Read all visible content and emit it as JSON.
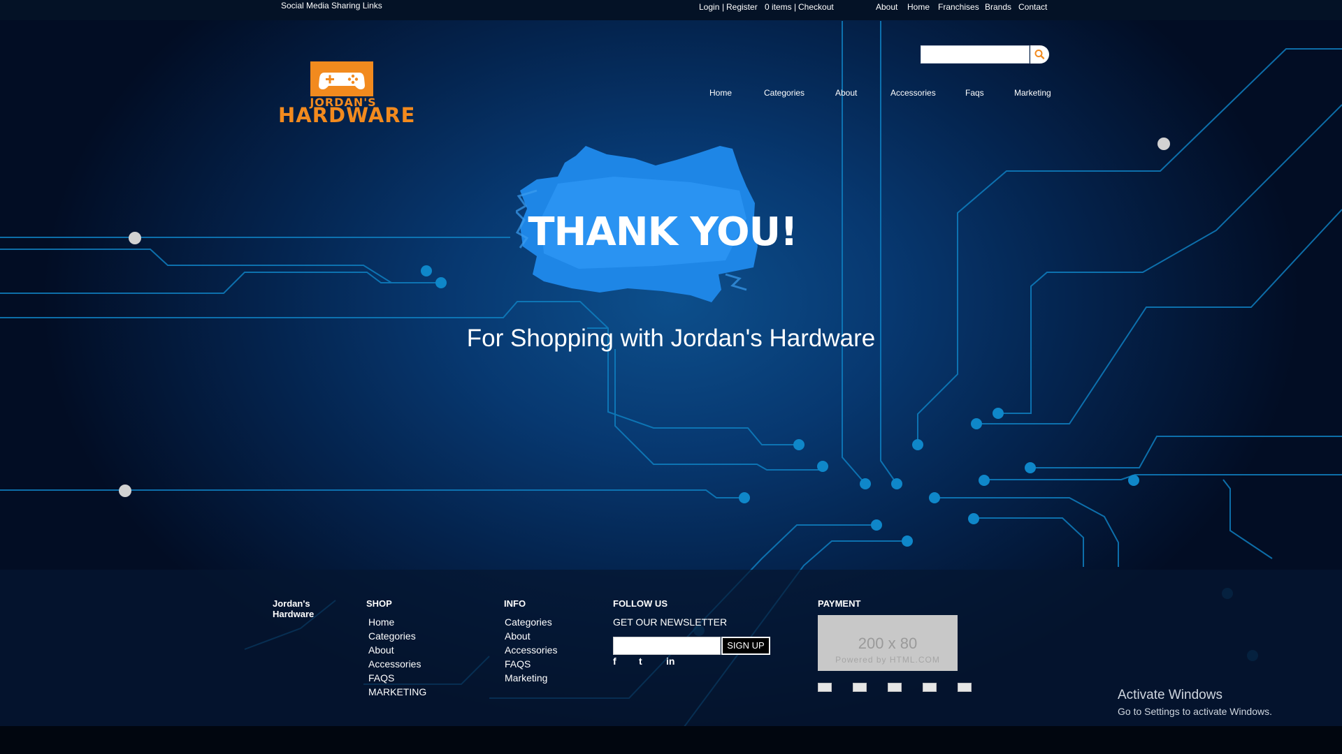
{
  "topbar": {
    "social_text": "Social Media Sharing Links",
    "login": "Login",
    "sep1": "|",
    "register": "Register",
    "cart_items": "0 items",
    "sep2": "|",
    "checkout": "Checkout",
    "links": [
      "About",
      "Home",
      "Franchises",
      "Brands",
      "Contact"
    ]
  },
  "logo": {
    "line1": "JORDAN'S",
    "line2": "HARDWARE",
    "icon": "gamepad-icon",
    "color": "#f28a1e"
  },
  "search": {
    "placeholder": "",
    "icon": "search-icon",
    "icon_color": "#f28a1e"
  },
  "nav": {
    "items": [
      "Home",
      "Categories",
      "About",
      "Accessories",
      "Faqs",
      "Marketing"
    ]
  },
  "hero": {
    "title": "THANK YOU!",
    "subtitle": "For Shopping with Jordan's Hardware",
    "brush_color": "#2a8ff0"
  },
  "footer": {
    "brand": "Jordan's\nHardware",
    "shop": {
      "title": "SHOP",
      "links": [
        "Home",
        "Categories",
        "About",
        "Accessories",
        "FAQS",
        "MARKETING"
      ]
    },
    "info": {
      "title": "INFO",
      "links": [
        "Categories",
        "About",
        "Accessories",
        "FAQS",
        "Marketing"
      ]
    },
    "follow": {
      "title": "FOLLOW US",
      "newsletter_label": "GET OUR NEWSLETTER",
      "newsletter_value": "",
      "signup_label": "SIGN UP",
      "social": [
        {
          "icon": "facebook-icon",
          "glyph": "f"
        },
        {
          "icon": "tumblr-icon",
          "glyph": "t"
        },
        {
          "icon": "linkedin-icon",
          "glyph": "in"
        }
      ]
    },
    "payment": {
      "title": "PAYMENT",
      "placeholder_size": "200 x 80",
      "placeholder_credit": "Powered by HTML.COM",
      "icons": [
        "payment-card-icon",
        "payment-card-icon",
        "payment-card-icon",
        "payment-card-icon",
        "payment-card-icon"
      ]
    }
  },
  "os_overlay": {
    "title": "Activate Windows",
    "subtitle": "Go to Settings to activate Windows."
  },
  "colors": {
    "accent": "#f28a1e",
    "circuit": "#0f85c7",
    "node_grey": "#cfcfcf"
  }
}
